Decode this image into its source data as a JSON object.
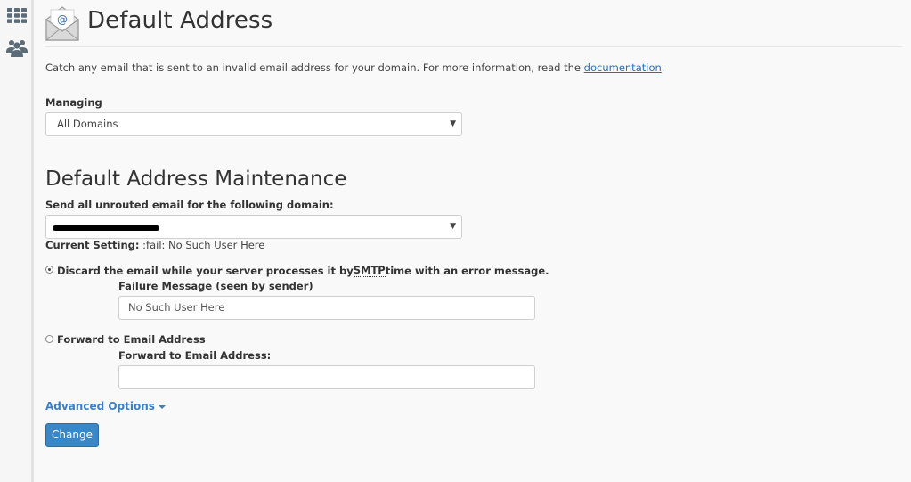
{
  "page": {
    "title": "Default Address",
    "intro_text": "Catch any email that is sent to an invalid email address for your domain. For more information, read the ",
    "intro_link": "documentation",
    "intro_end": "."
  },
  "managing": {
    "label": "Managing",
    "selected": "All Domains"
  },
  "maintenance": {
    "heading": "Default Address Maintenance",
    "domain_label": "Send all unrouted email for the following domain:",
    "current_label": "Current Setting:",
    "current_value": " :fail: No Such User Here"
  },
  "discard": {
    "text_before": "Discard the email while your server processes it by ",
    "abbr": "SMTP",
    "text_after": " time with an error message.",
    "failure_label": "Failure Message (seen by sender)",
    "failure_value": "No Such User Here"
  },
  "forward": {
    "option_label": "Forward to Email Address",
    "field_label": "Forward to Email Address:",
    "field_value": ""
  },
  "advanced": {
    "label": "Advanced Options"
  },
  "actions": {
    "change_label": "Change"
  },
  "colors": {
    "accent": "#3a87c8",
    "link": "#2a6fb6",
    "sidebar_icon": "#5b6b78"
  },
  "icons": {
    "apps": "grid-icon",
    "users": "users-icon",
    "page": "email-envelope-icon"
  }
}
